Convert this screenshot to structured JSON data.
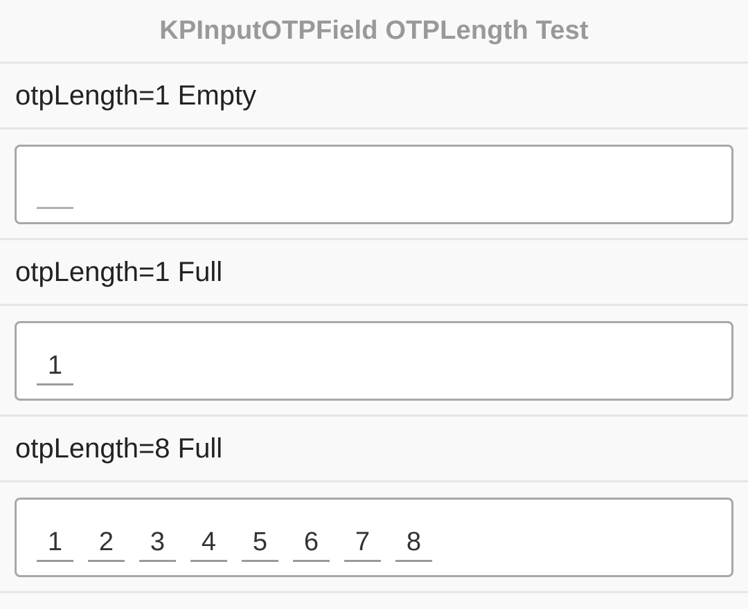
{
  "header": {
    "title": "KPInputOTPField OTPLength Test"
  },
  "sections": [
    {
      "label": "otpLength=1 Empty",
      "cells": [
        ""
      ]
    },
    {
      "label": "otpLength=1 Full",
      "cells": [
        "1"
      ]
    },
    {
      "label": "otpLength=8 Full",
      "cells": [
        "1",
        "2",
        "3",
        "4",
        "5",
        "6",
        "7",
        "8"
      ]
    }
  ],
  "colors": {
    "background": "#f9f9f9",
    "divider": "#e6e6e6",
    "field_border": "#a8a8a8",
    "title_text": "#999999",
    "label_text": "#222222"
  }
}
